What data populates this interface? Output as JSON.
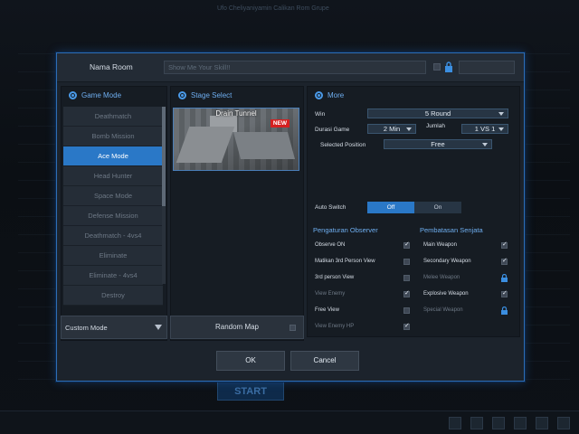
{
  "background": {
    "header_text": "Ufo Cheliyaniyamin Calikan Rom Grupe",
    "start_label": "START"
  },
  "room": {
    "name_label": "Nama Room",
    "name_placeholder": "Show Me Your Skill!!"
  },
  "game_mode": {
    "title": "Game Mode",
    "items": [
      "Deathmatch",
      "Bomb Mission",
      "Ace Mode",
      "Head Hunter",
      "Space Mode",
      "Defense Mission",
      "Deathmatch - 4vs4",
      "Eliminate",
      "Eliminate - 4vs4",
      "Destroy"
    ],
    "selected": "Ace Mode",
    "custom_mode": "Custom Mode"
  },
  "stage": {
    "title": "Stage Select",
    "map_name": "Drain Tunnel",
    "badge": "NEW",
    "random_map": "Random Map"
  },
  "more": {
    "title": "More",
    "win_label": "Win",
    "win_value": "5 Round",
    "duration_label": "Durasi Game",
    "duration_value": "2 Min",
    "count_label": "Jumlah",
    "count_value": "1 VS 1",
    "position_label": "Selected Position",
    "position_value": "Free",
    "autoswitch_label": "Auto Switch",
    "off_label": "Off",
    "on_label": "On"
  },
  "observer": {
    "title": "Pengaturan Observer",
    "options": [
      {
        "label": "Observe ON",
        "checked": true
      },
      {
        "label": "Matikan 3rd Person View",
        "checked": false
      },
      {
        "label": "3rd person View",
        "checked": false
      },
      {
        "label": "View Enemy",
        "checked": true
      },
      {
        "label": "Free View",
        "checked": false
      },
      {
        "label": "View Enemy HP",
        "checked": true
      }
    ]
  },
  "weapons": {
    "title": "Pembatasan Senjata",
    "options": [
      {
        "label": "Main Weapon",
        "checked": true
      },
      {
        "label": "Secondary Weapon",
        "checked": true
      },
      {
        "label": "Melee Weapon",
        "locked": true
      },
      {
        "label": "Explosive Weapon",
        "checked": true
      },
      {
        "label": "Special Weapon",
        "locked": true
      }
    ]
  },
  "buttons": {
    "ok": "OK",
    "cancel": "Cancel"
  },
  "colors": {
    "accent": "#2a78c7",
    "border": "#2f6db3",
    "heading": "#6eaef0"
  }
}
